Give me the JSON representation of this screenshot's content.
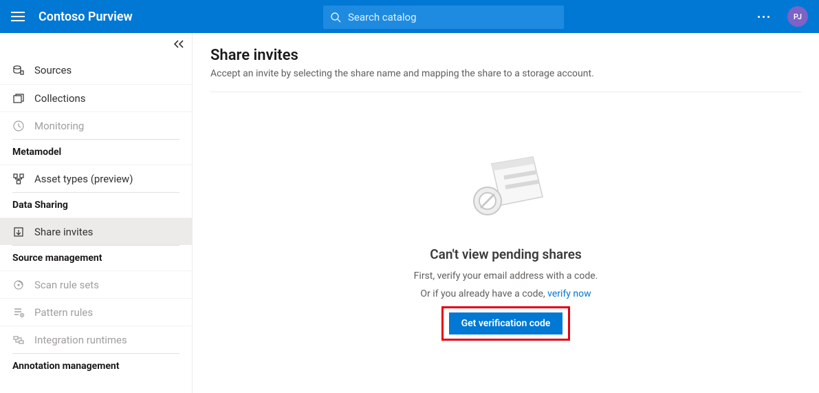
{
  "header": {
    "app_title": "Contoso Purview",
    "search_placeholder": "Search catalog",
    "avatar_initials": "PJ"
  },
  "sidebar": {
    "items": [
      {
        "label": "Sources"
      },
      {
        "label": "Collections"
      },
      {
        "label": "Monitoring"
      }
    ],
    "group_metamodel": "Metamodel",
    "metamodel_items": [
      {
        "label": "Asset types (preview)"
      }
    ],
    "group_datasharing": "Data Sharing",
    "datasharing_items": [
      {
        "label": "Share invites"
      }
    ],
    "group_sourcemgmt": "Source management",
    "sourcemgmt_items": [
      {
        "label": "Scan rule sets"
      },
      {
        "label": "Pattern rules"
      },
      {
        "label": "Integration runtimes"
      }
    ],
    "group_annotation": "Annotation management"
  },
  "main": {
    "title": "Share invites",
    "subtitle": "Accept an invite by selecting the share name and mapping the share to a storage account.",
    "empty_title": "Can't view pending shares",
    "empty_line1": "First, verify your email address with a code.",
    "empty_line2a": "Or if you already have a code, ",
    "empty_link": "verify now",
    "button": "Get verification code"
  }
}
